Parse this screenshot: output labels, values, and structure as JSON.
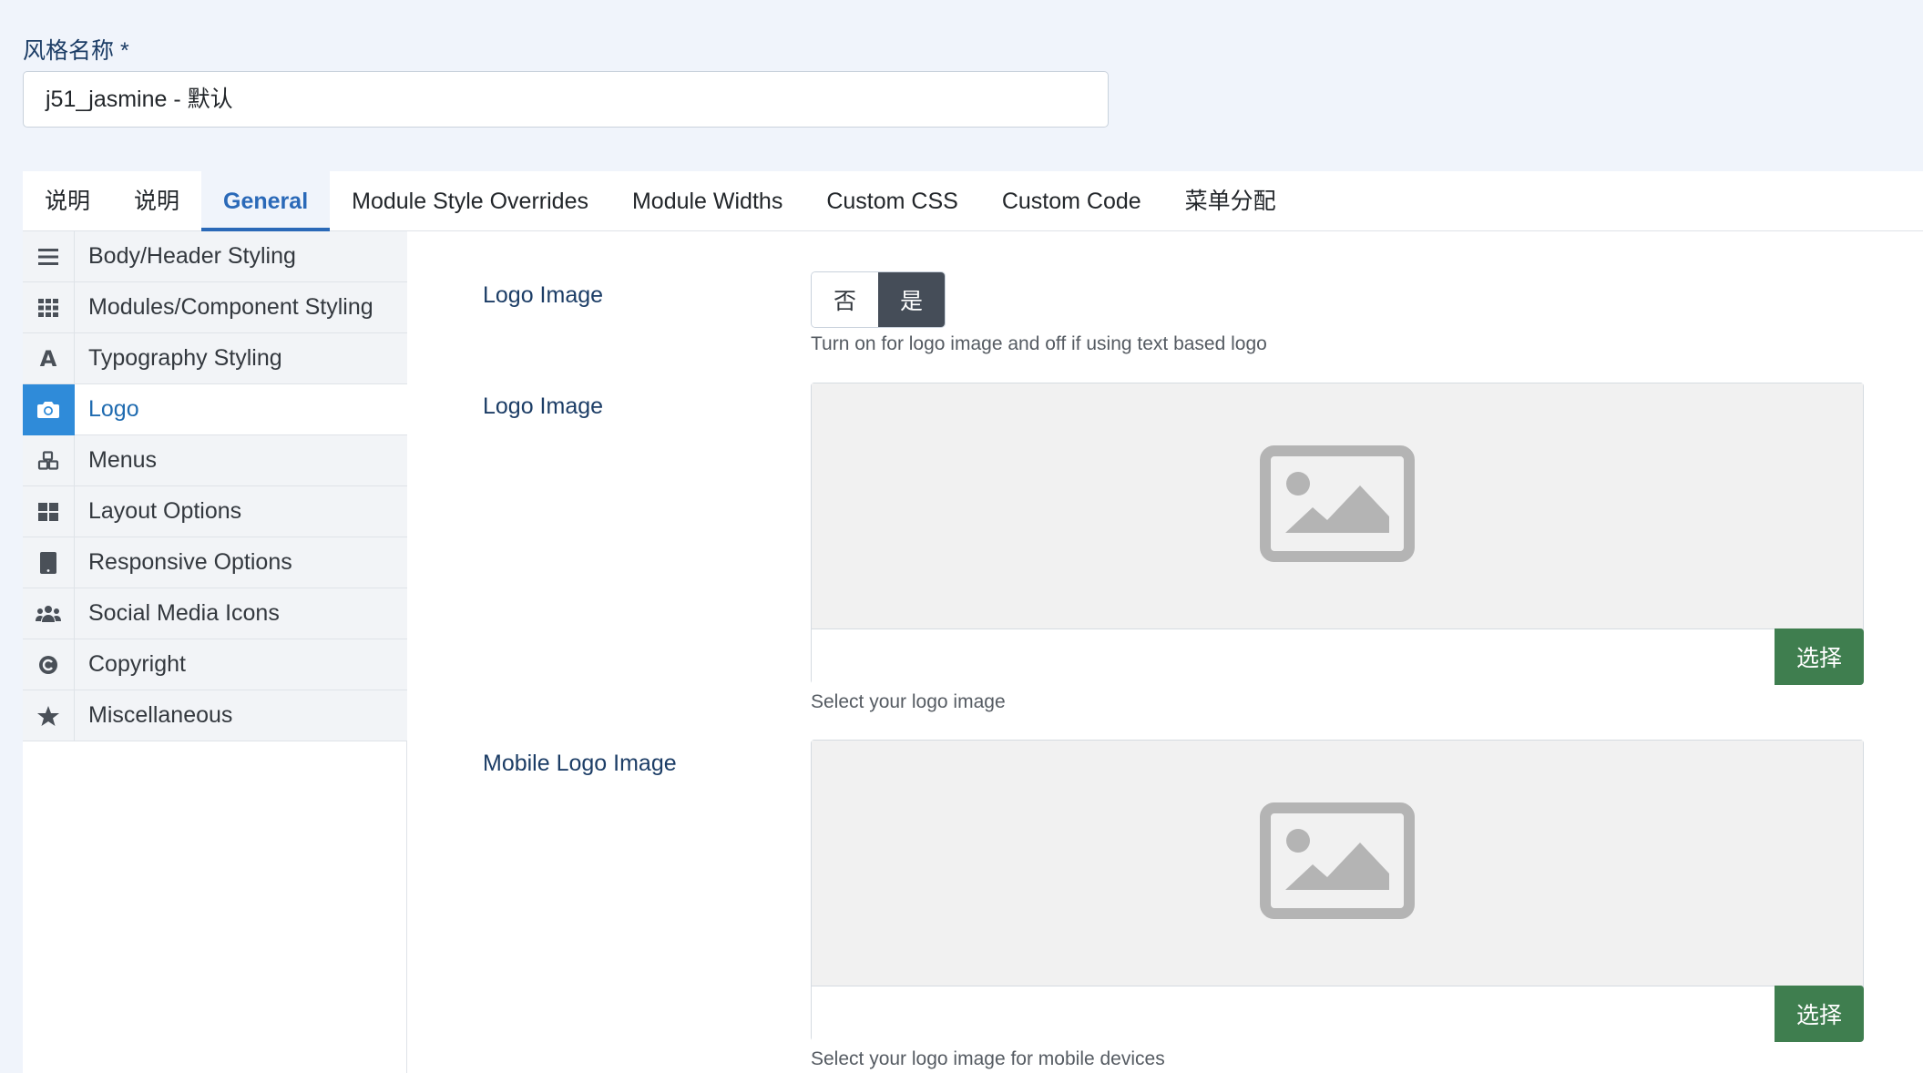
{
  "form": {
    "style_name_label": "风格名称 *",
    "style_name_value": "j51_jasmine - 默认"
  },
  "tabs": [
    {
      "label": "说明"
    },
    {
      "label": "说明"
    },
    {
      "label": "General"
    },
    {
      "label": "Module Style Overrides"
    },
    {
      "label": "Module Widths"
    },
    {
      "label": "Custom CSS"
    },
    {
      "label": "Custom Code"
    },
    {
      "label": "菜单分配"
    }
  ],
  "active_tab": "General",
  "sidebar": {
    "items": [
      {
        "label": "Body/Header Styling",
        "icon": "bars-icon"
      },
      {
        "label": "Modules/Component Styling",
        "icon": "grid-icon"
      },
      {
        "label": "Typography Styling",
        "icon": "font-icon"
      },
      {
        "label": "Logo",
        "icon": "camera-icon"
      },
      {
        "label": "Menus",
        "icon": "cubes-icon"
      },
      {
        "label": "Layout Options",
        "icon": "layout-icon"
      },
      {
        "label": "Responsive Options",
        "icon": "tablet-icon"
      },
      {
        "label": "Social Media Icons",
        "icon": "users-icon"
      },
      {
        "label": "Copyright",
        "icon": "copyright-icon"
      },
      {
        "label": "Miscellaneous",
        "icon": "star-icon"
      }
    ],
    "active": "Logo"
  },
  "logo": {
    "toggle_label": "Logo Image",
    "toggle_off": "否",
    "toggle_on": "是",
    "toggle_value": "是",
    "toggle_help": "Turn on for logo image and off if using text based logo",
    "image_label": "Logo Image",
    "image_value": "",
    "image_help": "Select your logo image",
    "mobile_label": "Mobile Logo Image",
    "mobile_value": "",
    "mobile_help": "Select your logo image for mobile devices",
    "select_button": "选择"
  },
  "colors": {
    "accent": "#2a69b8",
    "active_nav_icon_bg": "#2f8bd9",
    "select_button": "#3f7e4f",
    "toggle_on": "#454d58"
  }
}
